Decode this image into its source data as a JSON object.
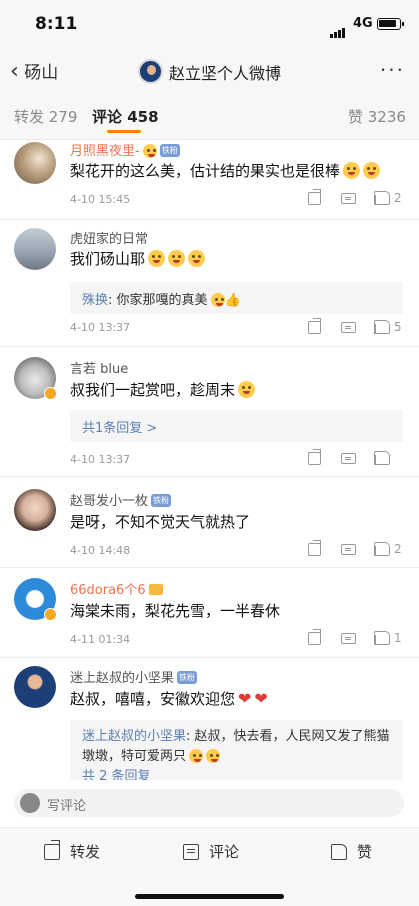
{
  "status_bar": {
    "time": "8:11",
    "network": "4G"
  },
  "nav": {
    "back_label": "砀山",
    "title": "赵立坚个人微博"
  },
  "tabs": [
    {
      "label": "转发 279"
    },
    {
      "label": "评论 458"
    },
    {
      "label": "赞 3236"
    }
  ],
  "comments": [
    {
      "name": "月照黑夜里-",
      "badge": "铁粉",
      "text": "梨花开的这么美，估计结的果实也是很棒",
      "date": "4-10 15:45",
      "likes": "2"
    },
    {
      "name": "虎妞家的日常",
      "text": "我们砀山耶",
      "reply_name": "殊换",
      "reply_text": ": 你家那嘎的真美",
      "date": "4-10 13:37",
      "likes": "5"
    },
    {
      "name": "言若 blue",
      "text": "叔我们一起赏吧，趁周末",
      "more_replies": "共1条回复 >",
      "date": "4-10 13:37",
      "likes": ""
    },
    {
      "name": "赵哥发小一枚",
      "badge": "铁粉",
      "text": "是呀，不知不觉天气就热了",
      "date": "4-10 14:48",
      "likes": "2"
    },
    {
      "name": "66dora6个6",
      "text": "海棠未雨，梨花先雪，一半春休",
      "date": "4-11 01:34",
      "likes": "1"
    },
    {
      "name": "迷上赵叔的小坚果",
      "badge": "铁粉",
      "text": "赵叔，嘻嘻，安徽欢迎您",
      "reply_name": "迷上赵叔的小坚果",
      "reply_text": ": 赵叔，快去看，人民网又发了熊猫墩墩，特可爱两只",
      "more_replies": "共 2 条回复"
    }
  ],
  "composer": {
    "placeholder": "写评论"
  },
  "bottom_bar": {
    "share": "转发",
    "comment": "评论",
    "like": "赞"
  }
}
